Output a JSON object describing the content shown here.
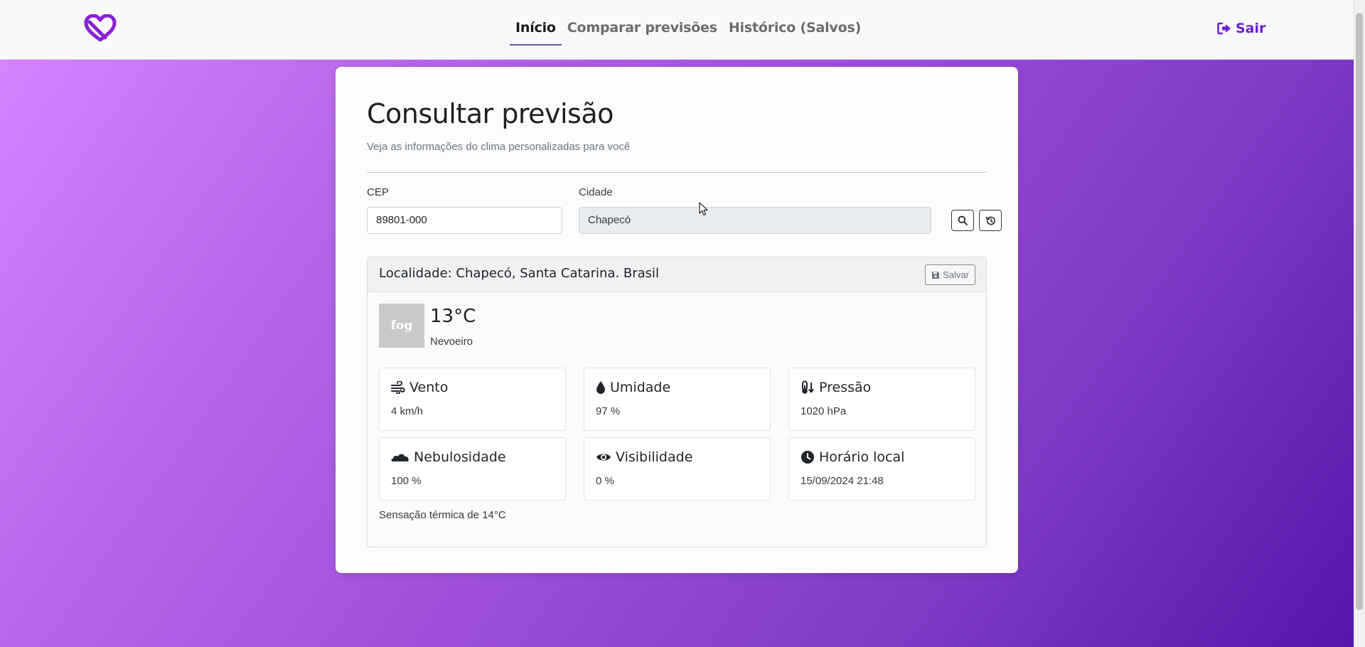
{
  "nav": {
    "links": [
      {
        "label": "Início",
        "active": true
      },
      {
        "label": "Comparar previsões",
        "active": false
      },
      {
        "label": "Histórico (Salvos)",
        "active": false
      }
    ],
    "logout_label": "Sair"
  },
  "page": {
    "title": "Consultar previsão",
    "subtitle": "Veja as informações do clima personalizadas para você"
  },
  "form": {
    "cep_label": "CEP",
    "cep_value": "89801-000",
    "city_label": "Cidade",
    "city_value": "Chapecó"
  },
  "result": {
    "location": "Localidade: Chapecó, Santa Catarina. Brasil",
    "save_label": "Salvar",
    "icon_text": "fog",
    "temperature": "13°C",
    "description": "Nevoeiro",
    "stats": {
      "wind": {
        "title": "Vento",
        "value": "4 km/h"
      },
      "humidity": {
        "title": "Umidade",
        "value": "97 %"
      },
      "pressure": {
        "title": "Pressão",
        "value": "1020 hPa"
      },
      "clouds": {
        "title": "Nebulosidade",
        "value": "100 %"
      },
      "visibility": {
        "title": "Visibilidade",
        "value": "0 %"
      },
      "local_time": {
        "title": "Horário local",
        "value": "15/09/2024 21:48"
      }
    },
    "feels_like": "Sensação térmica de 14°C"
  },
  "colors": {
    "brand": "#6b1fd6",
    "gradient_start": "#d484ff",
    "gradient_end": "#5616a9"
  }
}
